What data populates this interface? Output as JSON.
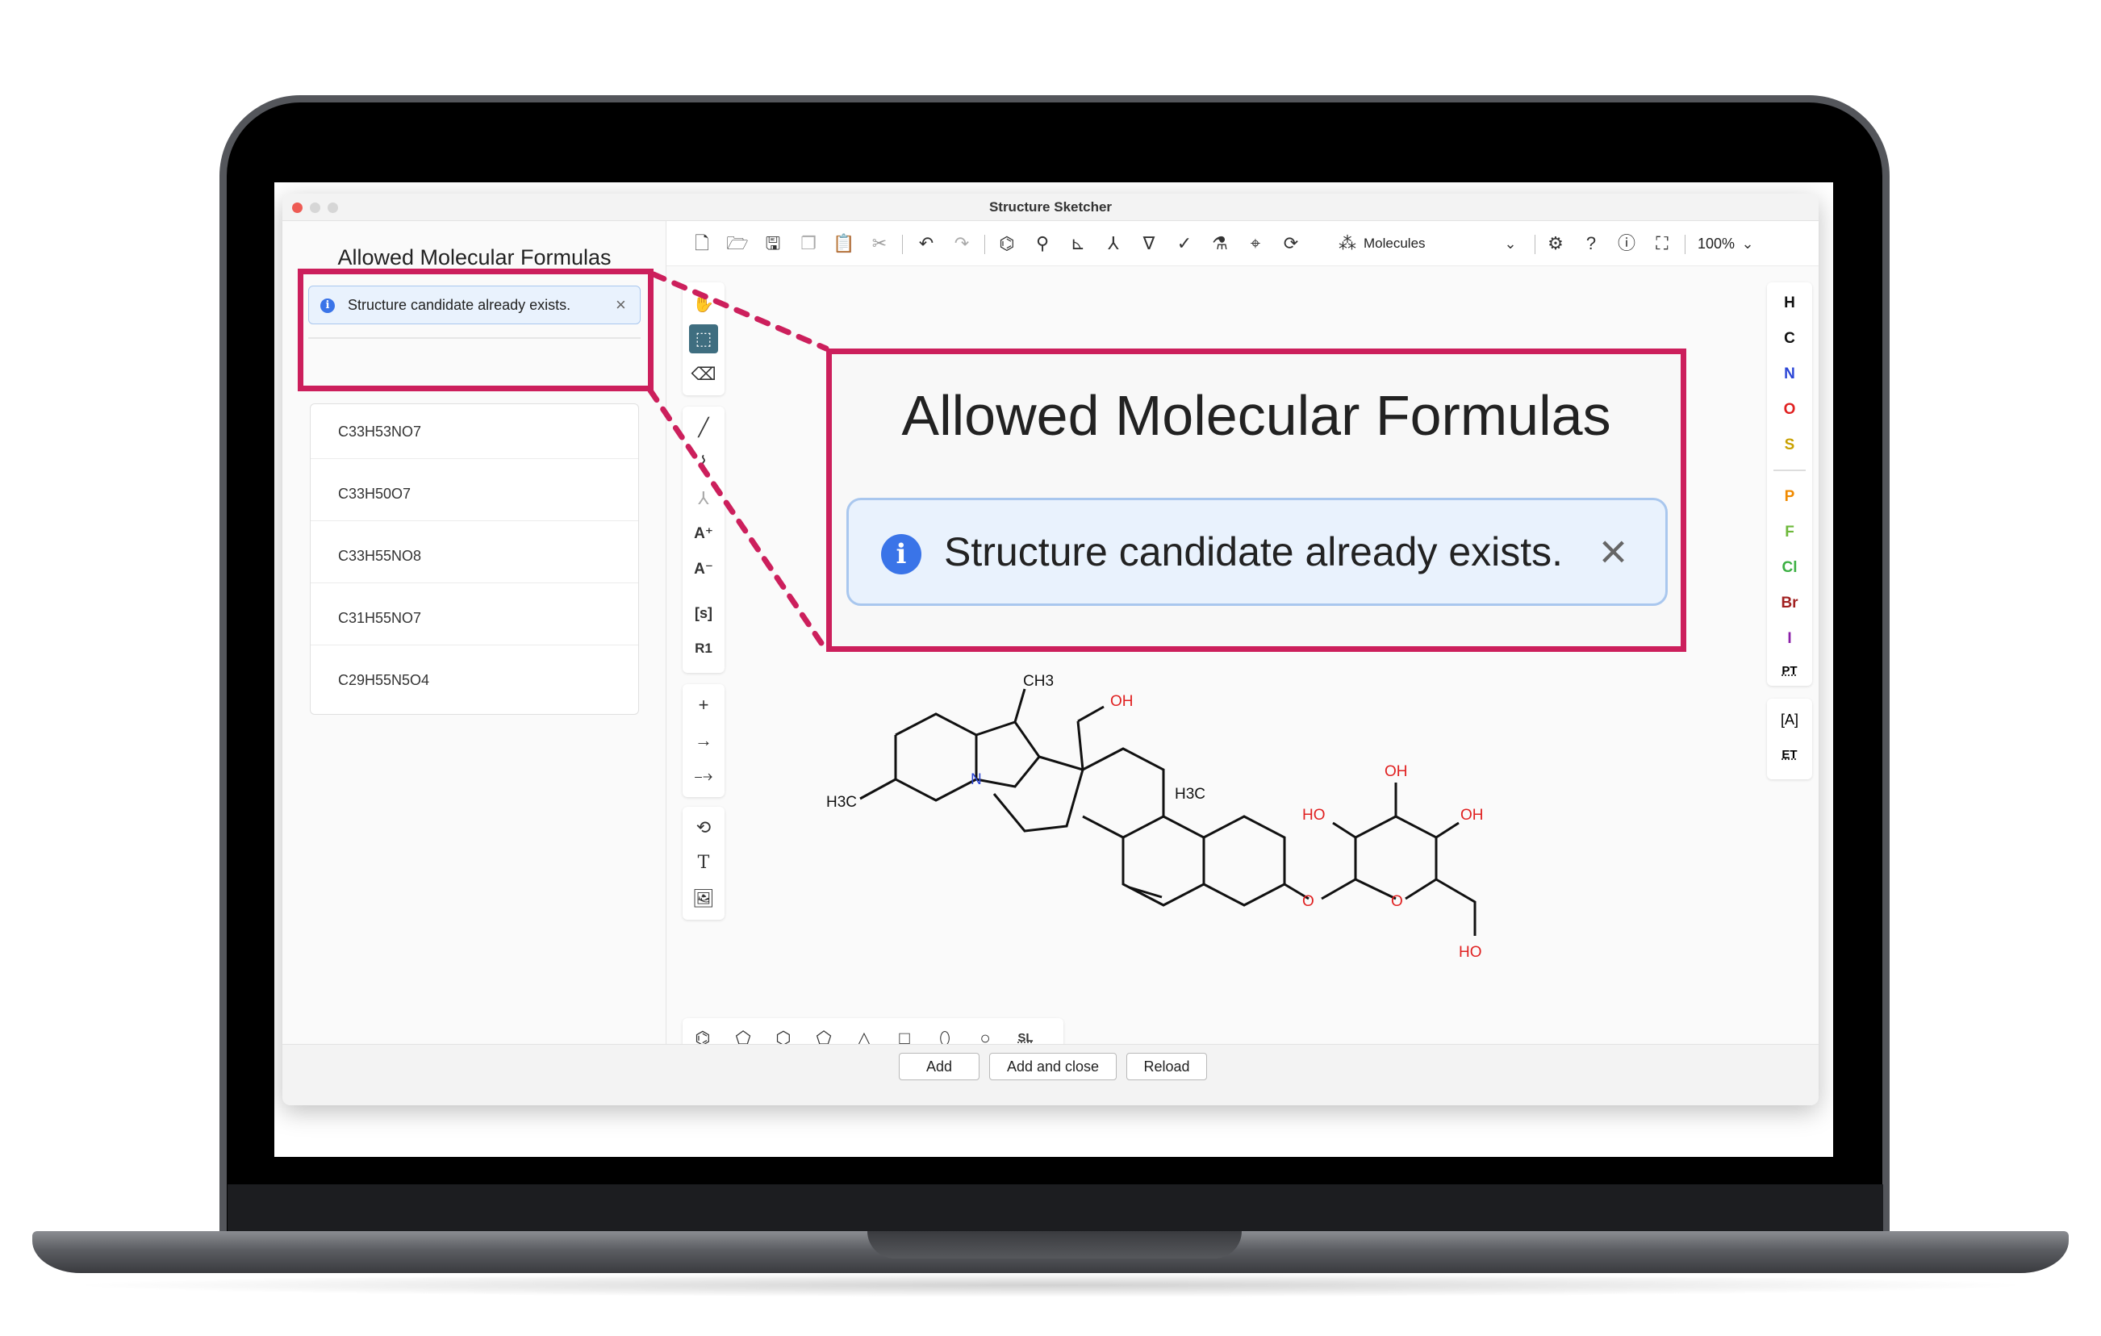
{
  "window": {
    "title": "Structure Sketcher"
  },
  "left_panel": {
    "title": "Allowed Molecular Formulas",
    "notice": "Structure candidate already exists.",
    "formulas": [
      "C33H53NO7",
      "C33H50O7",
      "C33H55NO8",
      "C31H55NO7",
      "C29H55N5O4"
    ]
  },
  "zoom": {
    "title": "Allowed Molecular Formulas",
    "notice": "Structure candidate already exists."
  },
  "toolbar": {
    "mode_label": "Molecules",
    "zoom_level": "100%"
  },
  "elements": [
    {
      "symbol": "H",
      "color": "#111111"
    },
    {
      "symbol": "C",
      "color": "#111111"
    },
    {
      "symbol": "N",
      "color": "#2b45d6"
    },
    {
      "symbol": "O",
      "color": "#e02020"
    },
    {
      "symbol": "S",
      "color": "#c9a100"
    },
    {
      "symbol": "P",
      "color": "#f08a00"
    },
    {
      "symbol": "F",
      "color": "#6db83a"
    },
    {
      "symbol": "Cl",
      "color": "#3cb043"
    },
    {
      "symbol": "Br",
      "color": "#a12020"
    },
    {
      "symbol": "I",
      "color": "#8b1fa8"
    }
  ],
  "element_extras": {
    "periodic_table": "PT",
    "extended": "ET"
  },
  "left_tools": {
    "sgroup": "[s]",
    "rgroup": "R1",
    "text": "T"
  },
  "bottom_tools": {
    "sl": "SL"
  },
  "buttons": {
    "add": "Add",
    "add_close": "Add and close",
    "reload": "Reload"
  },
  "molecule_labels": {
    "ch3_top": "CH3",
    "oh_top": "OH",
    "h3c_left": "H3C",
    "n": "N",
    "h3c_mid": "H3C",
    "ho_left": "HO",
    "oh_ring_top": "OH",
    "oh_right": "OH",
    "o_link": "O",
    "o_ring": "O",
    "ho_bottom": "HO"
  },
  "colors": {
    "highlight": "#cc1f5c",
    "notice_bg": "#e9f2fd",
    "info_blue": "#3a74e8",
    "heteroatom_red": "#e02020",
    "nitrogen_blue": "#2b45d6"
  }
}
